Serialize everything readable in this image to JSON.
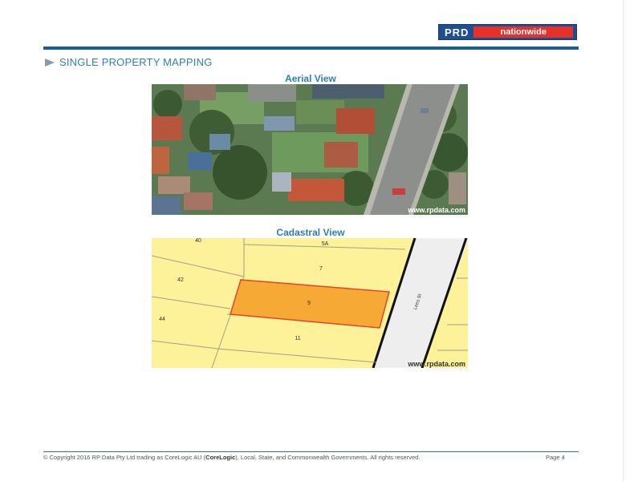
{
  "logo": {
    "brand": "PRD",
    "name": "nationwide"
  },
  "section": {
    "heading": "SINGLE PROPERTY MAPPING"
  },
  "aerial": {
    "title": "Aerial View",
    "watermark": "www.rpdata.com"
  },
  "cadastral": {
    "title": "Cadastral View",
    "watermark": "www.rpdata.com",
    "street": "Lees St",
    "lots": [
      "40",
      "5A",
      "7",
      "42",
      "9",
      "44",
      "11"
    ],
    "subject_lot": "9"
  },
  "footer": {
    "copyright_before": "© Copyright 2016 RP Data Pty Ltd trading as CoreLogic AU (",
    "copyright_brand": "CoreLogic",
    "copyright_after": "), Local, State, and Commonwealth Governments.  All rights reserved.",
    "page": "Page 4"
  },
  "colors": {
    "brand_blue": "#1f4f8e",
    "brand_red": "#e4322b",
    "heading_blue": "#2f7fb0",
    "subject_lot_fill": "#f6a935",
    "lot_fill": "#fdf29a"
  }
}
